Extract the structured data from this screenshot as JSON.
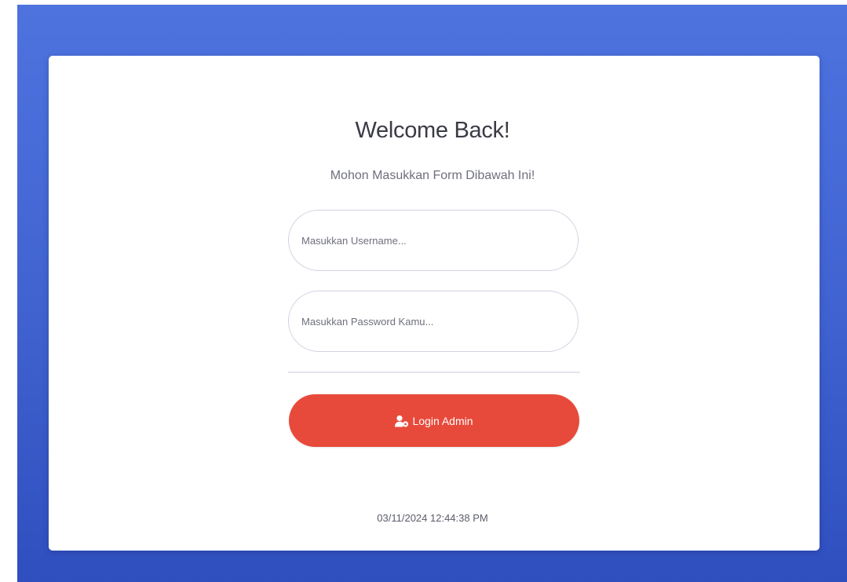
{
  "login": {
    "title": "Welcome Back!",
    "subtitle": "Mohon Masukkan Form Dibawah Ini!",
    "username_placeholder": "Masukkan Username...",
    "password_placeholder": "Masukkan Password Kamu...",
    "button_label": "Login Admin",
    "button_icon": "user-cog-icon",
    "timestamp": "03/11/2024 12:44:38 PM"
  },
  "colors": {
    "background_gradient_top": "#4e73df",
    "background_gradient_bottom": "#2f4fbf",
    "button": "#e74a3b",
    "card": "#ffffff"
  }
}
